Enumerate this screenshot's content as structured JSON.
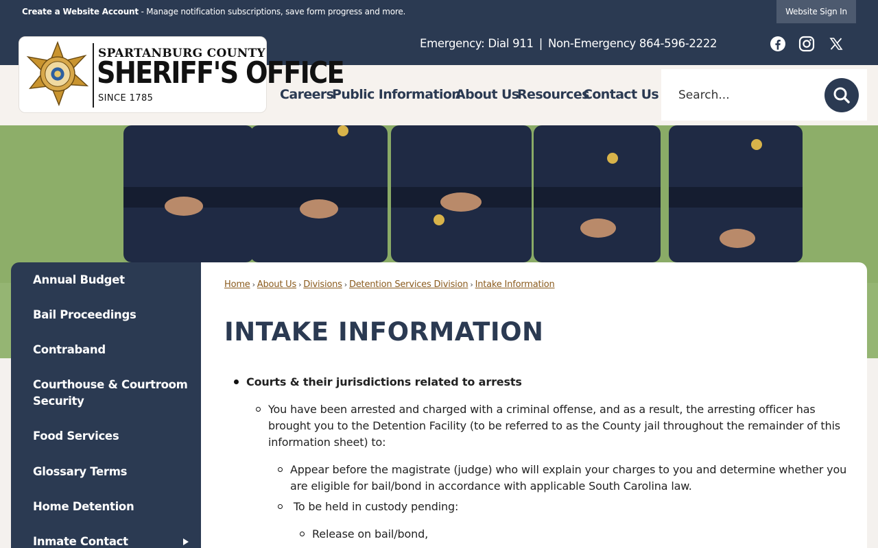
{
  "topbar": {
    "account_bold": "Create a Website Account",
    "account_text": " - Manage notification subscriptions, save form progress and more.",
    "sign_in": "Website Sign In"
  },
  "header": {
    "emergency": "Emergency: Dial 911",
    "separator": "|",
    "non_emergency": "Non-Emergency 864-596-2222",
    "social": [
      "facebook-icon",
      "instagram-icon",
      "x-icon"
    ]
  },
  "logo": {
    "line1": "SPARTANBURG COUNTY",
    "line2": "SHERIFF'S OFFICE",
    "line3": "SINCE 1785"
  },
  "nav": {
    "items": [
      "Careers",
      "Public Information",
      "About Us",
      "Resources",
      "Contact Us"
    ]
  },
  "search": {
    "placeholder": "Search..."
  },
  "sidebar": {
    "items": [
      "Annual Budget",
      "Bail Proceedings",
      "Contraband",
      "Courthouse & Courtroom Security",
      "Food Services",
      "Glossary Terms",
      "Home Detention",
      "Inmate Contact"
    ]
  },
  "breadcrumb": {
    "items": [
      "Home",
      "About Us",
      "Divisions",
      "Detention Services Division",
      "Intake Information"
    ],
    "separator": "›"
  },
  "page": {
    "title": "INTAKE INFORMATION",
    "l1_heading": "Courts & their jurisdictions related to arrests",
    "l2_text": "You have been arrested and charged with a criminal offense, and as a result, the arresting officer has brought you to the Detention Facility (to be referred to as the County jail throughout the remainder of this information sheet) to:",
    "l3_item1": "Appear before the magistrate (judge) who will explain your charges to you and determine whether you are eligible for bail/bond in accordance with applicable South Carolina law.",
    "l3_item2": " To be held in custody pending:",
    "l4_item1": "Release on bail/bond,"
  },
  "colors": {
    "navy": "#2b3a52",
    "link_brown": "#8a5a1c",
    "header_light": "#f6f2ee"
  }
}
